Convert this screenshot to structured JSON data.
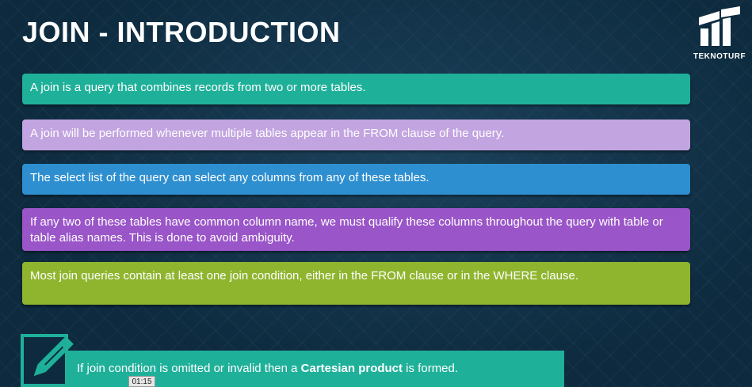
{
  "slide": {
    "title": "JOIN - INTRODUCTION",
    "logo_text": "TEKNOTURF",
    "points": [
      "A join is a query that combines records from two or more tables.",
      "A join will be performed whenever multiple tables appear in the FROM clause of the query.",
      "The select list of the query can select any columns from any of these tables.",
      "If any two of these tables have common column name, we must qualify these columns throughout the query with table or table alias names. This is done to avoid ambiguity.",
      "Most join queries contain at least one join condition, either in the FROM clause or in the WHERE clause."
    ],
    "note": {
      "prefix": "If join condition is omitted or invalid then a ",
      "bold": "Cartesian product",
      "suffix": " is formed."
    },
    "icon": "pencil-note-icon"
  },
  "player": {
    "timestamp": "01:15"
  },
  "colors": {
    "background": "#0d2a3e",
    "teal": "#1fb09a",
    "lavender": "#c2a4e0",
    "blue": "#2e8fd0",
    "purple": "#9a55c8",
    "green": "#8fb52f"
  }
}
